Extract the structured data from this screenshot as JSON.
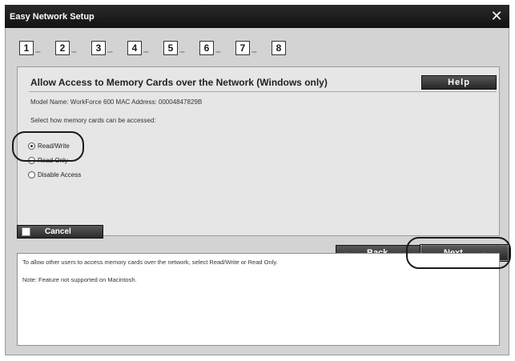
{
  "window": {
    "title": "Easy Network Setup"
  },
  "steps": [
    "1",
    "2",
    "3",
    "4",
    "5",
    "6",
    "7",
    "8"
  ],
  "content": {
    "heading": "Allow Access to Memory Cards over the Network (Windows only)",
    "help_label": "Help",
    "model_info": "Model Name: WorkForce 600    MAC Address: 00004847829B",
    "instruction": "Select how memory cards can be accessed:",
    "options": [
      {
        "label": "Read/Write",
        "selected": true
      },
      {
        "label": "Read Only",
        "selected": false
      },
      {
        "label": "Disable Access",
        "selected": false
      }
    ]
  },
  "buttons": {
    "cancel": "Cancel",
    "back": "Back",
    "next": "Next"
  },
  "info": {
    "line1": "To allow other users to access memory cards over the network, select Read/Write or Read Only.",
    "line2": "Note: Feature not supported on Macintosh."
  },
  "icons": {
    "close": "close-icon",
    "back_arrow": "arrow-left-icon",
    "next_arrow": "arrow-right-icon"
  }
}
